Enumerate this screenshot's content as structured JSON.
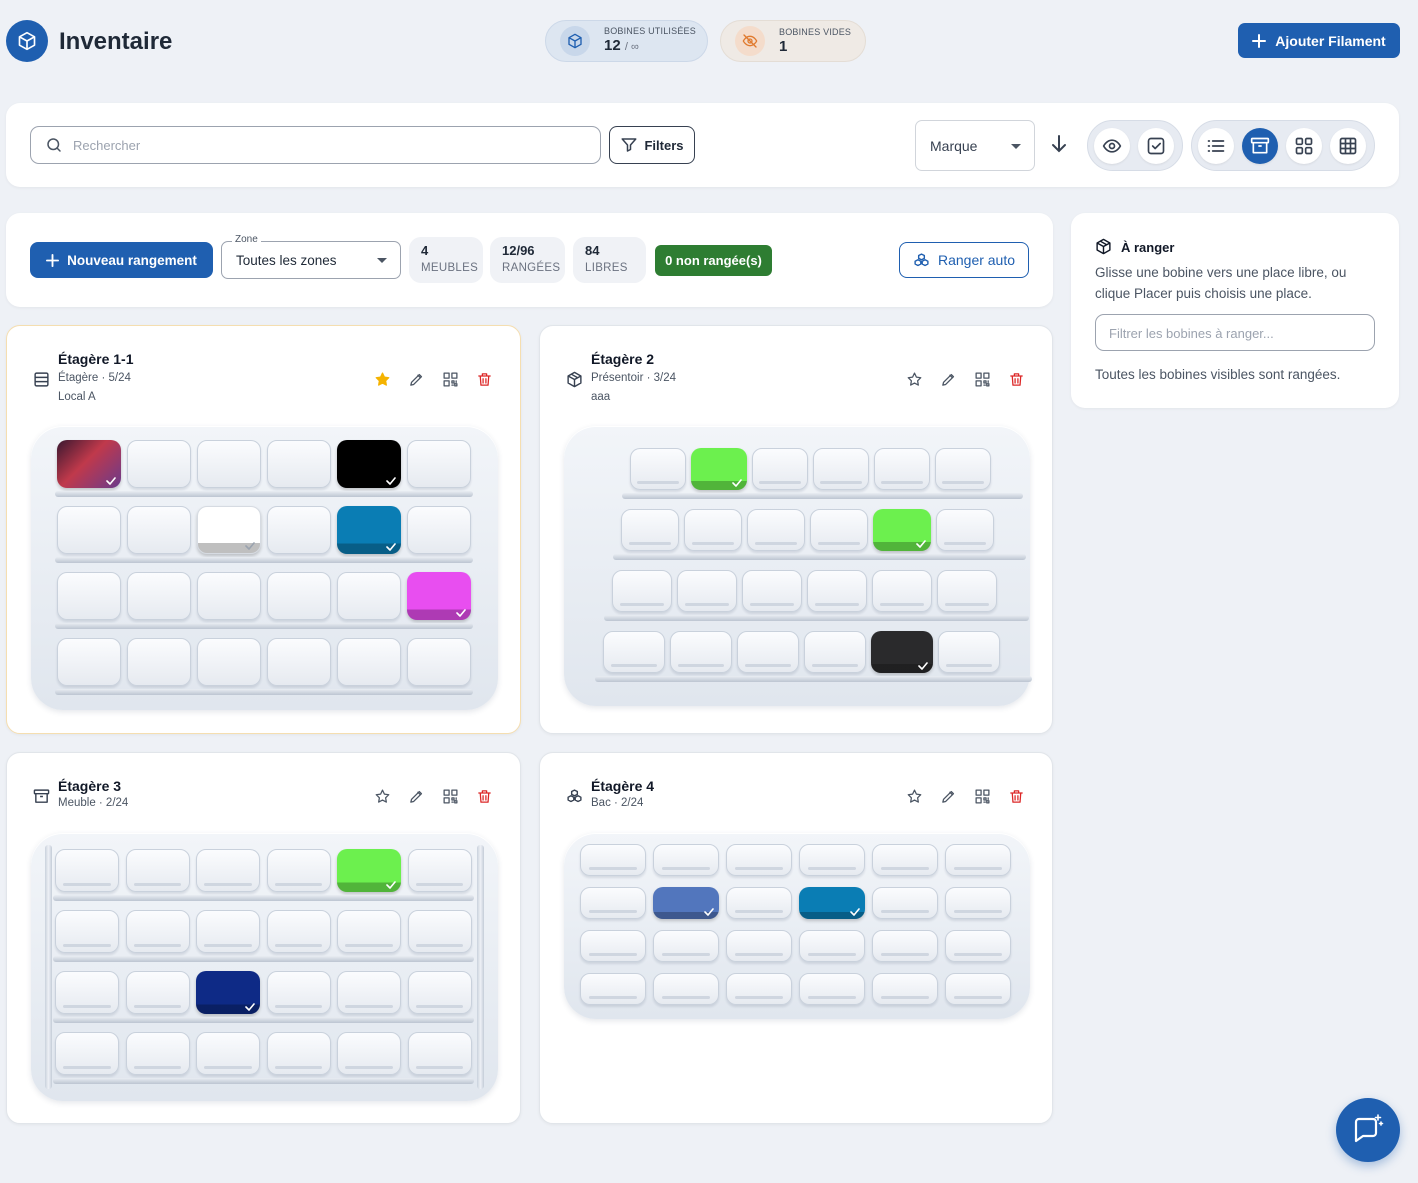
{
  "header": {
    "title": "Inventaire",
    "used_label": "BOBINES UTILISÉES",
    "used_value": "12",
    "used_suffix": "/ ∞",
    "empty_label": "BOBINES VIDES",
    "empty_value": "1",
    "add_label": "Ajouter Filament"
  },
  "toolbar": {
    "search_placeholder": "Rechercher",
    "filters_label": "Filters",
    "sort_value": "Marque",
    "toggle_icons": [
      "eye-icon",
      "check-square-icon"
    ],
    "view_icons": [
      "list-view-icon",
      "storage-view-icon",
      "grid-view-icon",
      "table-view-icon"
    ],
    "active_view": "storage-view-icon"
  },
  "storage_bar": {
    "new_label": "Nouveau rangement",
    "zone_label": "Zone",
    "zone_value": "Toutes les zones",
    "stats": [
      {
        "value": "4",
        "label": "MEUBLES"
      },
      {
        "value": "12/96",
        "label": "RANGÉES"
      },
      {
        "value": "84",
        "label": "LIBRES"
      }
    ],
    "unranged": "0 non rangée(s)",
    "auto_label": "Ranger auto"
  },
  "colors": {
    "primary": "#1f5fb0",
    "success": "#2e7d32",
    "danger": "#dc2626",
    "star_active": "#f5b301"
  },
  "shelves": [
    {
      "title": "Étagère 1-1",
      "subtitle": "Étagère · 5/24",
      "location": "Local A",
      "icon": "shelf-icon",
      "favorite": true,
      "rows": 4,
      "cols": 6,
      "spools": [
        {
          "row": 0,
          "col": 0,
          "color": "#7a2b3f",
          "gradient": "linear-gradient(135deg,#3a1830 0%,#c0394b 45%,#6a3a8c 100%)"
        },
        {
          "row": 0,
          "col": 4,
          "color": "#000000"
        },
        {
          "row": 1,
          "col": 2,
          "color": "#ffffff"
        },
        {
          "row": 1,
          "col": 4,
          "color": "#0a7db4"
        },
        {
          "row": 2,
          "col": 5,
          "color": "#e84ef0"
        }
      ]
    },
    {
      "title": "Étagère 2",
      "subtitle": "Présentoir · 3/24",
      "location": "aaa",
      "icon": "box-3d-icon",
      "favorite": false,
      "rows": 4,
      "cols": 6,
      "spools": [
        {
          "row": 0,
          "col": 1,
          "color": "#6cf04e"
        },
        {
          "row": 1,
          "col": 4,
          "color": "#6cf04e"
        },
        {
          "row": 3,
          "col": 4,
          "color": "#2a2a2c"
        }
      ]
    },
    {
      "title": "Étagère 3",
      "subtitle": "Meuble · 2/24",
      "location": "",
      "icon": "archive-icon",
      "favorite": false,
      "rows": 4,
      "cols": 6,
      "spools": [
        {
          "row": 0,
          "col": 4,
          "color": "#6cf04e"
        },
        {
          "row": 2,
          "col": 2,
          "color": "#0e2a86"
        }
      ]
    },
    {
      "title": "Étagère 4",
      "subtitle": "Bac · 2/24",
      "location": "",
      "icon": "boxes-icon",
      "favorite": false,
      "rows": 4,
      "cols": 6,
      "spools": [
        {
          "row": 1,
          "col": 1,
          "color": "#5276bd"
        },
        {
          "row": 1,
          "col": 3,
          "color": "#0a7db4"
        }
      ]
    }
  ],
  "sidebar": {
    "title": "À ranger",
    "description": "Glisse une bobine vers une place libre, ou clique Placer puis choisis une place.",
    "filter_placeholder": "Filtrer les bobines à ranger...",
    "empty_note": "Toutes les bobines visibles sont rangées."
  }
}
